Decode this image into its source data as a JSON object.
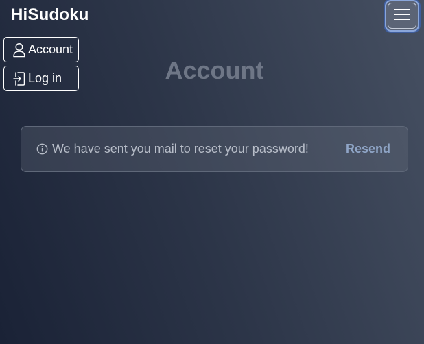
{
  "header": {
    "brand": "HiSudoku",
    "menu_icon": "hamburger-menu-icon"
  },
  "nav": {
    "items": [
      {
        "label": "Account",
        "icon": "user-icon"
      },
      {
        "label": "Log in",
        "icon": "login-icon"
      }
    ]
  },
  "main": {
    "title": "Account",
    "alert": {
      "icon": "info-icon",
      "message": "We have sent you mail to reset your password!",
      "action_label": "Resend"
    }
  },
  "colors": {
    "background_start": "#1a2236",
    "background_end": "#465062",
    "title": "#6e7686",
    "alert_text": "#b7bdc8",
    "action_link": "#8fa5c6",
    "toggle_focus_ring": "#3f5e9e"
  }
}
